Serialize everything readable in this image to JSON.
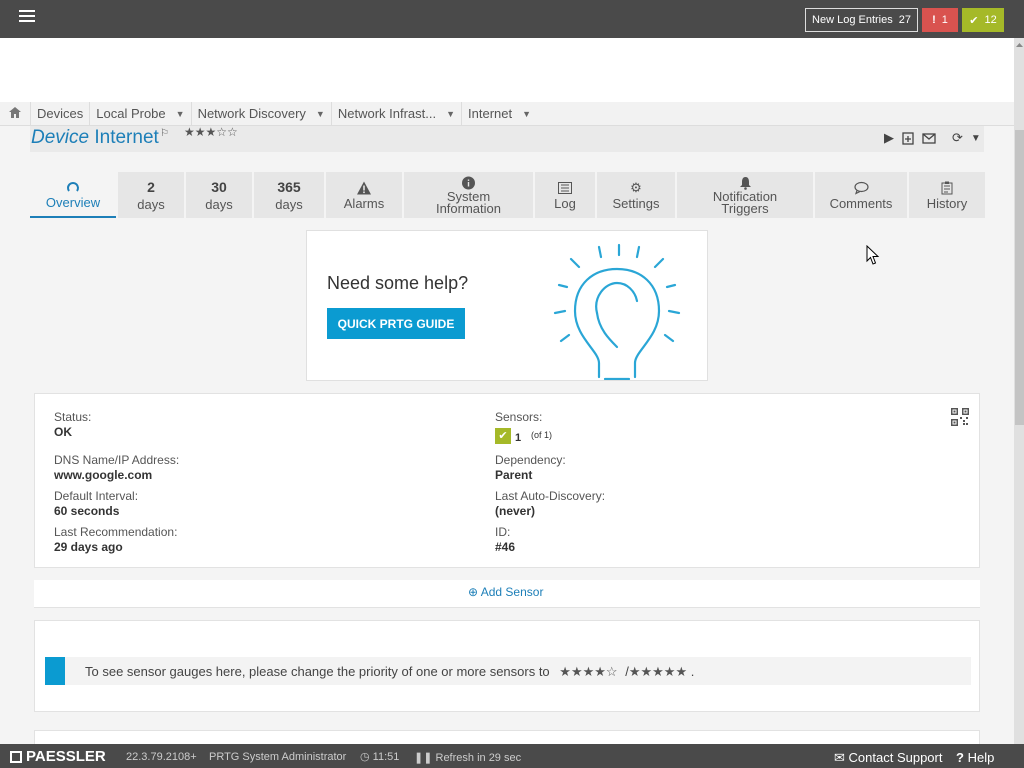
{
  "topbar": {
    "menu_icon": "hamburger-icon",
    "log_entries_label": "New Log Entries",
    "log_entries_count": "27",
    "alarm_count": "1",
    "ok_count": "12",
    "colors": {
      "bar": "#4a4a4a",
      "alarm": "#d9534f",
      "ok": "#a5b928"
    }
  },
  "breadcrumb": {
    "home_icon": "home-icon",
    "items": [
      {
        "label": "Devices"
      },
      {
        "label": "Local Probe"
      },
      {
        "label": "Network Discovery"
      },
      {
        "label": "Network Infrast..."
      },
      {
        "label": "Internet"
      }
    ]
  },
  "device": {
    "type_label": "Device",
    "name": "Internet",
    "priority_stars": "★★★☆☆",
    "tools": [
      "play-icon",
      "add-icon",
      "mail-icon",
      "refresh-icon",
      "caret-down-icon"
    ]
  },
  "tabs": [
    {
      "label": "Overview",
      "icon": "gauge-icon",
      "active": true
    },
    {
      "num": "2",
      "label": "days"
    },
    {
      "num": "30",
      "label": "days"
    },
    {
      "num": "365",
      "label": "days"
    },
    {
      "label": "Alarms",
      "icon": "warning-icon"
    },
    {
      "label1": "System",
      "label2": "Information",
      "icon": "info-icon"
    },
    {
      "label": "Log",
      "icon": "list-icon"
    },
    {
      "label": "Settings",
      "icon": "gear-icon"
    },
    {
      "label1": "Notification",
      "label2": "Triggers",
      "icon": "bell-icon"
    },
    {
      "label": "Comments",
      "icon": "comment-icon"
    },
    {
      "label": "History",
      "icon": "history-icon"
    }
  ],
  "help": {
    "title": "Need some help?",
    "button": "QUICK PRTG GUIDE"
  },
  "info": {
    "status_label": "Status:",
    "status_value": "OK",
    "dns_label": "DNS Name/IP Address:",
    "dns_value": "www.google.com",
    "interval_label": "Default Interval:",
    "interval_value": "60 seconds",
    "recommendation_label": "Last Recommendation:",
    "recommendation_value": "29 days ago",
    "sensors_label": "Sensors:",
    "sensors_count": "1",
    "sensors_of": "(of 1)",
    "dependency_label": "Dependency:",
    "dependency_value": "Parent",
    "autodiscovery_label": "Last Auto-Discovery:",
    "autodiscovery_value": "(never)",
    "id_label": "ID:",
    "id_value": "#46"
  },
  "add_sensor": "Add Sensor",
  "gauges": {
    "message": "To see sensor gauges here, please change the priority of one or more sensors to",
    "stars_four": "★★★★☆",
    "separator": "/",
    "stars_five": "★★★★★",
    "tail": "."
  },
  "footer": {
    "brand": "PAESSLER",
    "version": "22.3.79.2108+",
    "user": "PRTG System Administrator",
    "time": "11:51",
    "refresh": "Refresh in 29 sec",
    "support": "Contact Support",
    "help": "Help"
  }
}
